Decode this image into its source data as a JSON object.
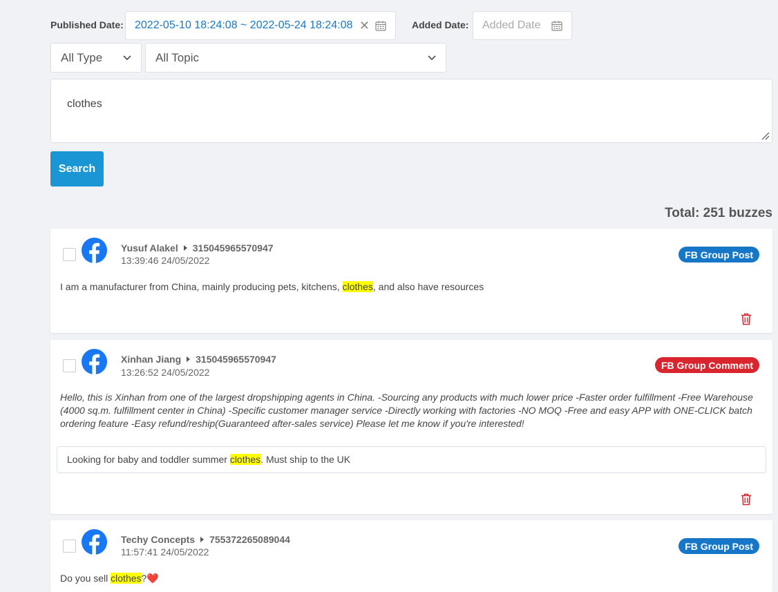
{
  "filters": {
    "published_label": "Published Date:",
    "published_range": "2022-05-10 18:24:08 ~ 2022-05-24 18:24:08",
    "added_label": "Added Date:",
    "added_placeholder": "Added Date",
    "type_select": "All Type",
    "topic_select": "All Topic",
    "query": "clothes",
    "search_button": "Search"
  },
  "total": "Total: 251 buzzes",
  "buzzes": [
    {
      "author": "Yusuf Alakel",
      "group_id": "315045965570947",
      "time": "13:39:46 24/05/2022",
      "type": "FB Group Post",
      "content_pre": "I am a manufacturer from China, mainly producing pets, kitchens, ",
      "content_hl": "clothes",
      "content_post": ", and also have resources"
    },
    {
      "author": "Xinhan Jiang",
      "group_id": "315045965570947",
      "time": "13:26:52 24/05/2022",
      "type": "FB Group Comment",
      "content": "Hello, this is Xinhan from one of the largest dropshipping agents in China. -Sourcing any products with much lower price -Faster order fulfillment -Free Warehouse (4000 sq.m. fulfillment center in China) -Specific customer manager service -Directly working with factories -NO MOQ -Free and easy APP with ONE-CLICK batch ordering feature -Easy refund/reship(Guaranteed after-sales service) Please let me know if you're interested!",
      "quote_pre": "Looking for baby and toddler summer ",
      "quote_hl": "clothes",
      "quote_post": ". Must ship to the UK"
    },
    {
      "author": "Techy Concepts",
      "group_id": "755372265089044",
      "time": "11:57:41 24/05/2022",
      "type": "FB Group Post",
      "content_pre": "Do you sell ",
      "content_hl": "clothes",
      "content_post": "?",
      "emoji": "❤️"
    }
  ],
  "colors": {
    "accent": "#1a96d4",
    "post_badge": "#1677c8",
    "comment_badge": "#d9262e",
    "highlight": "#ffff00",
    "trash": "#d9262e",
    "facebook": "#1877f2"
  }
}
